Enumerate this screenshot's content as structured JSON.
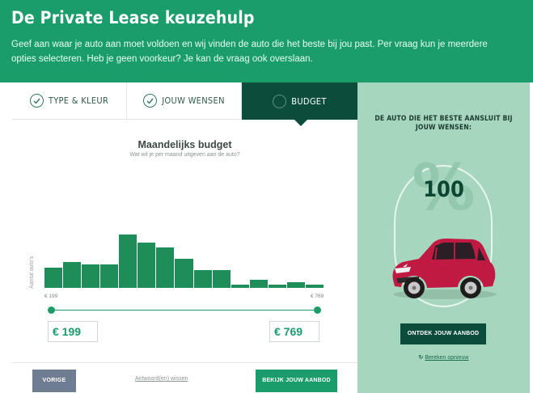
{
  "hero": {
    "title": "De Private Lease keuzehulp",
    "subtitle": "Geef aan waar je auto aan moet voldoen en wij vinden de auto die het beste bij jou past. Per vraag kun je meerdere opties selecteren. Heb je geen voorkeur? Je kan de vraag ook overslaan."
  },
  "tabs": [
    {
      "label": "TYPE & KLEUR",
      "state": "completed"
    },
    {
      "label": "JOUW WENSEN",
      "state": "completed"
    },
    {
      "label": "BUDGET",
      "state": "active"
    }
  ],
  "question": {
    "title": "Maandelijks budget",
    "subtitle": "Wat wil je per maand uitgeven aan de auto?"
  },
  "histogram": {
    "y_label": "Aantal auto's",
    "min_label": "€ 199",
    "max_label": "€ 769",
    "bar_color": "#1e8d58",
    "relative_counts": [
      0.38,
      0.49,
      0.44,
      0.44,
      1.0,
      0.85,
      0.76,
      0.54,
      0.34,
      0.34,
      0.06,
      0.15,
      0.06,
      0.11,
      0.06
    ]
  },
  "slider": {
    "min_value": "€ 199",
    "max_value": "€ 769"
  },
  "footer": {
    "prev_label": "VORIGE",
    "reset_label": "Antwoord(en) wissen",
    "offer_label": "BEKIJK JOUW AANBOD"
  },
  "panel": {
    "title": "DE AUTO DIE HET BESTE AANSLUIT BIJ JOUW WENSEN:",
    "percent_symbol": "%",
    "score": "100",
    "discover_label": "ONTDEK JOUW AANBOD",
    "recalc_icon": "refresh-icon",
    "recalc_label": "Bereken opnieuw"
  },
  "colors": {
    "brand_green": "#1a9d6a",
    "dark_green": "#0b4d3a",
    "panel_green": "#a6d6bd",
    "button_grey": "#6f7d92",
    "car_red": "#c01a43"
  }
}
